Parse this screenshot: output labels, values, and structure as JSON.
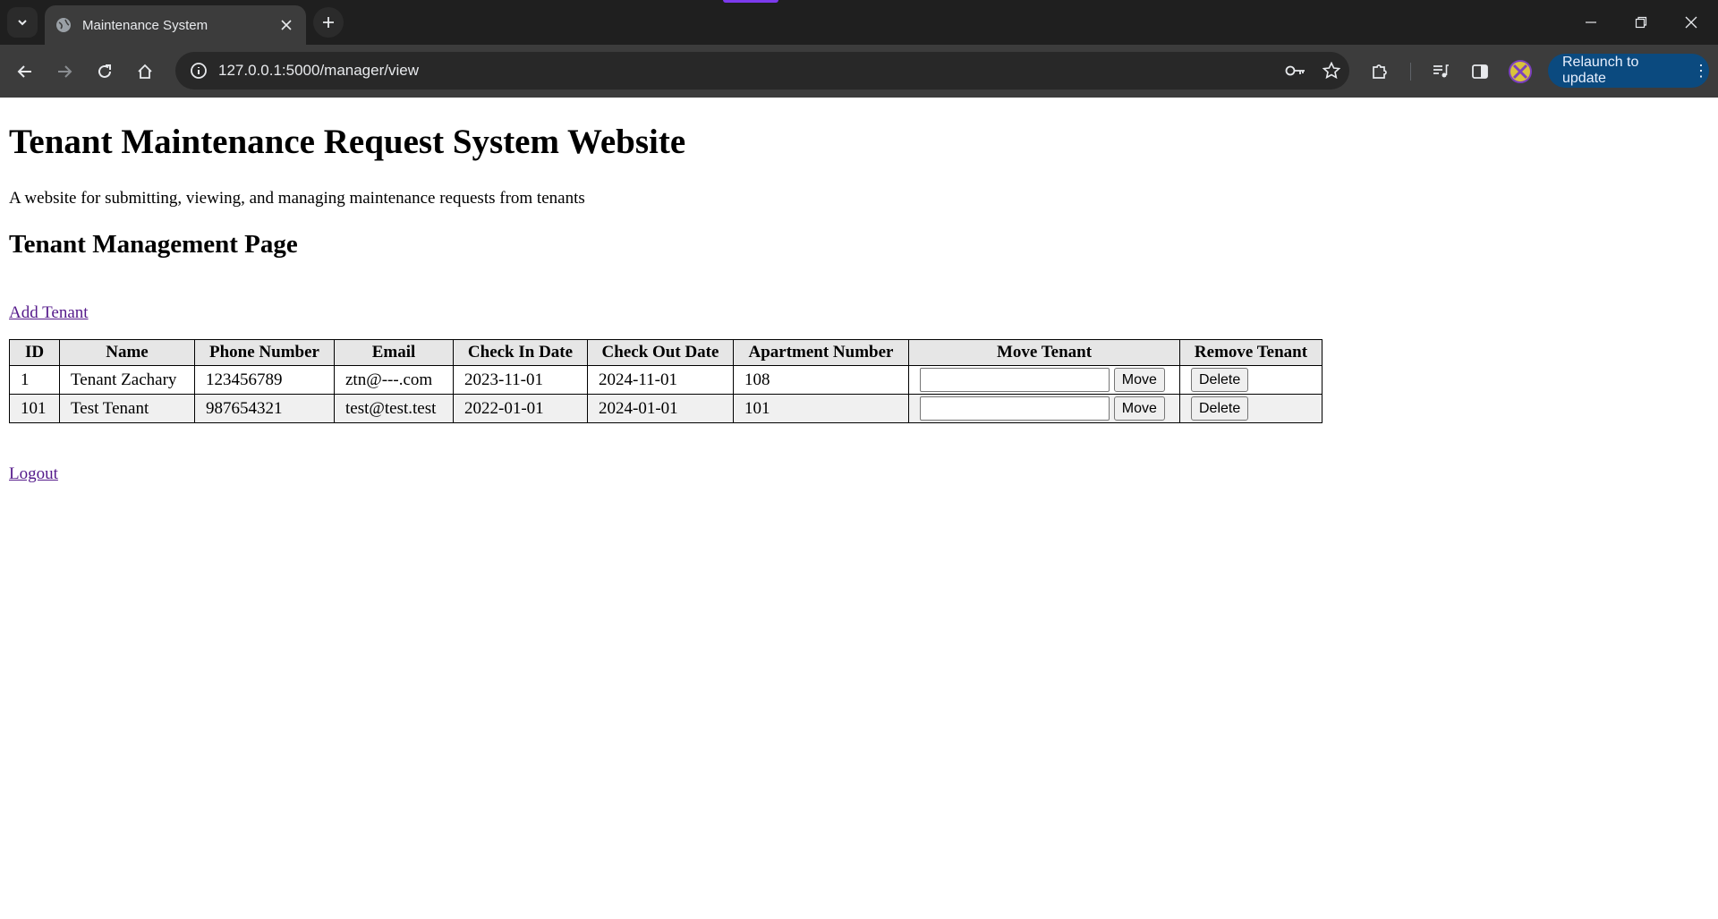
{
  "browser": {
    "tab_title": "Maintenance System",
    "url": "127.0.0.1:5000/manager/view",
    "relaunch_label": "Relaunch to update"
  },
  "page": {
    "title": "Tenant Maintenance Request System Website",
    "description": "A website for submitting, viewing, and managing maintenance requests from tenants",
    "subtitle": "Tenant Management Page",
    "add_tenant_label": "Add Tenant",
    "logout_label": "Logout"
  },
  "table": {
    "headers": [
      "ID",
      "Name",
      "Phone Number",
      "Email",
      "Check In Date",
      "Check Out Date",
      "Apartment Number",
      "Move Tenant",
      "Remove Tenant"
    ],
    "rows": [
      {
        "id": "1",
        "name": "Tenant Zachary",
        "phone": "123456789",
        "email": "ztn@---.com",
        "check_in": "2023-11-01",
        "check_out": "2024-11-01",
        "apartment": "108",
        "move_value": "",
        "move_label": "Move",
        "delete_label": "Delete"
      },
      {
        "id": "101",
        "name": "Test Tenant",
        "phone": "987654321",
        "email": "test@test.test",
        "check_in": "2022-01-01",
        "check_out": "2024-01-01",
        "apartment": "101",
        "move_value": "",
        "move_label": "Move",
        "delete_label": "Delete"
      }
    ]
  },
  "colors": {
    "visited_link": "#551a8b",
    "chrome_dark": "#202124",
    "relaunch_button": "#0b4a7f",
    "table_header_bg": "#e6e6e6"
  },
  "icons": [
    "tab-search-icon",
    "globe-favicon-icon",
    "close-icon",
    "plus-icon",
    "minimize-icon",
    "restore-icon",
    "window-close-icon",
    "back-arrow-icon",
    "forward-arrow-icon",
    "reload-icon",
    "home-icon",
    "site-info-icon",
    "password-key-icon",
    "bookmark-star-icon",
    "extensions-puzzle-icon",
    "media-control-icon",
    "side-panel-icon",
    "profile-avatar-icon",
    "kebab-menu-icon"
  ]
}
